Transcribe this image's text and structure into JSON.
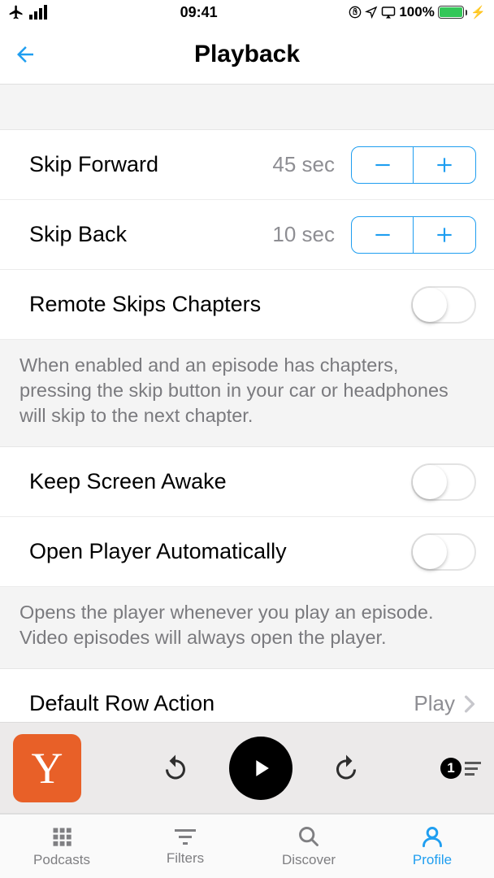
{
  "status": {
    "time": "09:41",
    "battery_pct": "100%"
  },
  "nav": {
    "title": "Playback"
  },
  "skip_forward": {
    "label": "Skip Forward",
    "value": "45 sec"
  },
  "skip_back": {
    "label": "Skip Back",
    "value": "10 sec"
  },
  "remote_skips": {
    "label": "Remote Skips Chapters",
    "enabled": false,
    "hint": "When enabled and an episode has chapters, pressing the skip button in your car or headphones will skip to the next chapter."
  },
  "keep_awake": {
    "label": "Keep Screen Awake",
    "enabled": false
  },
  "open_player": {
    "label": "Open Player Automatically",
    "enabled": false,
    "hint": "Opens the player whenever you play an episode. Video episodes will always open the player."
  },
  "default_row": {
    "label": "Default Row Action",
    "value": "Play"
  },
  "mini_player": {
    "art_letter": "Y",
    "queue_count": "1"
  },
  "tabs": {
    "podcasts": "Podcasts",
    "filters": "Filters",
    "discover": "Discover",
    "profile": "Profile"
  }
}
